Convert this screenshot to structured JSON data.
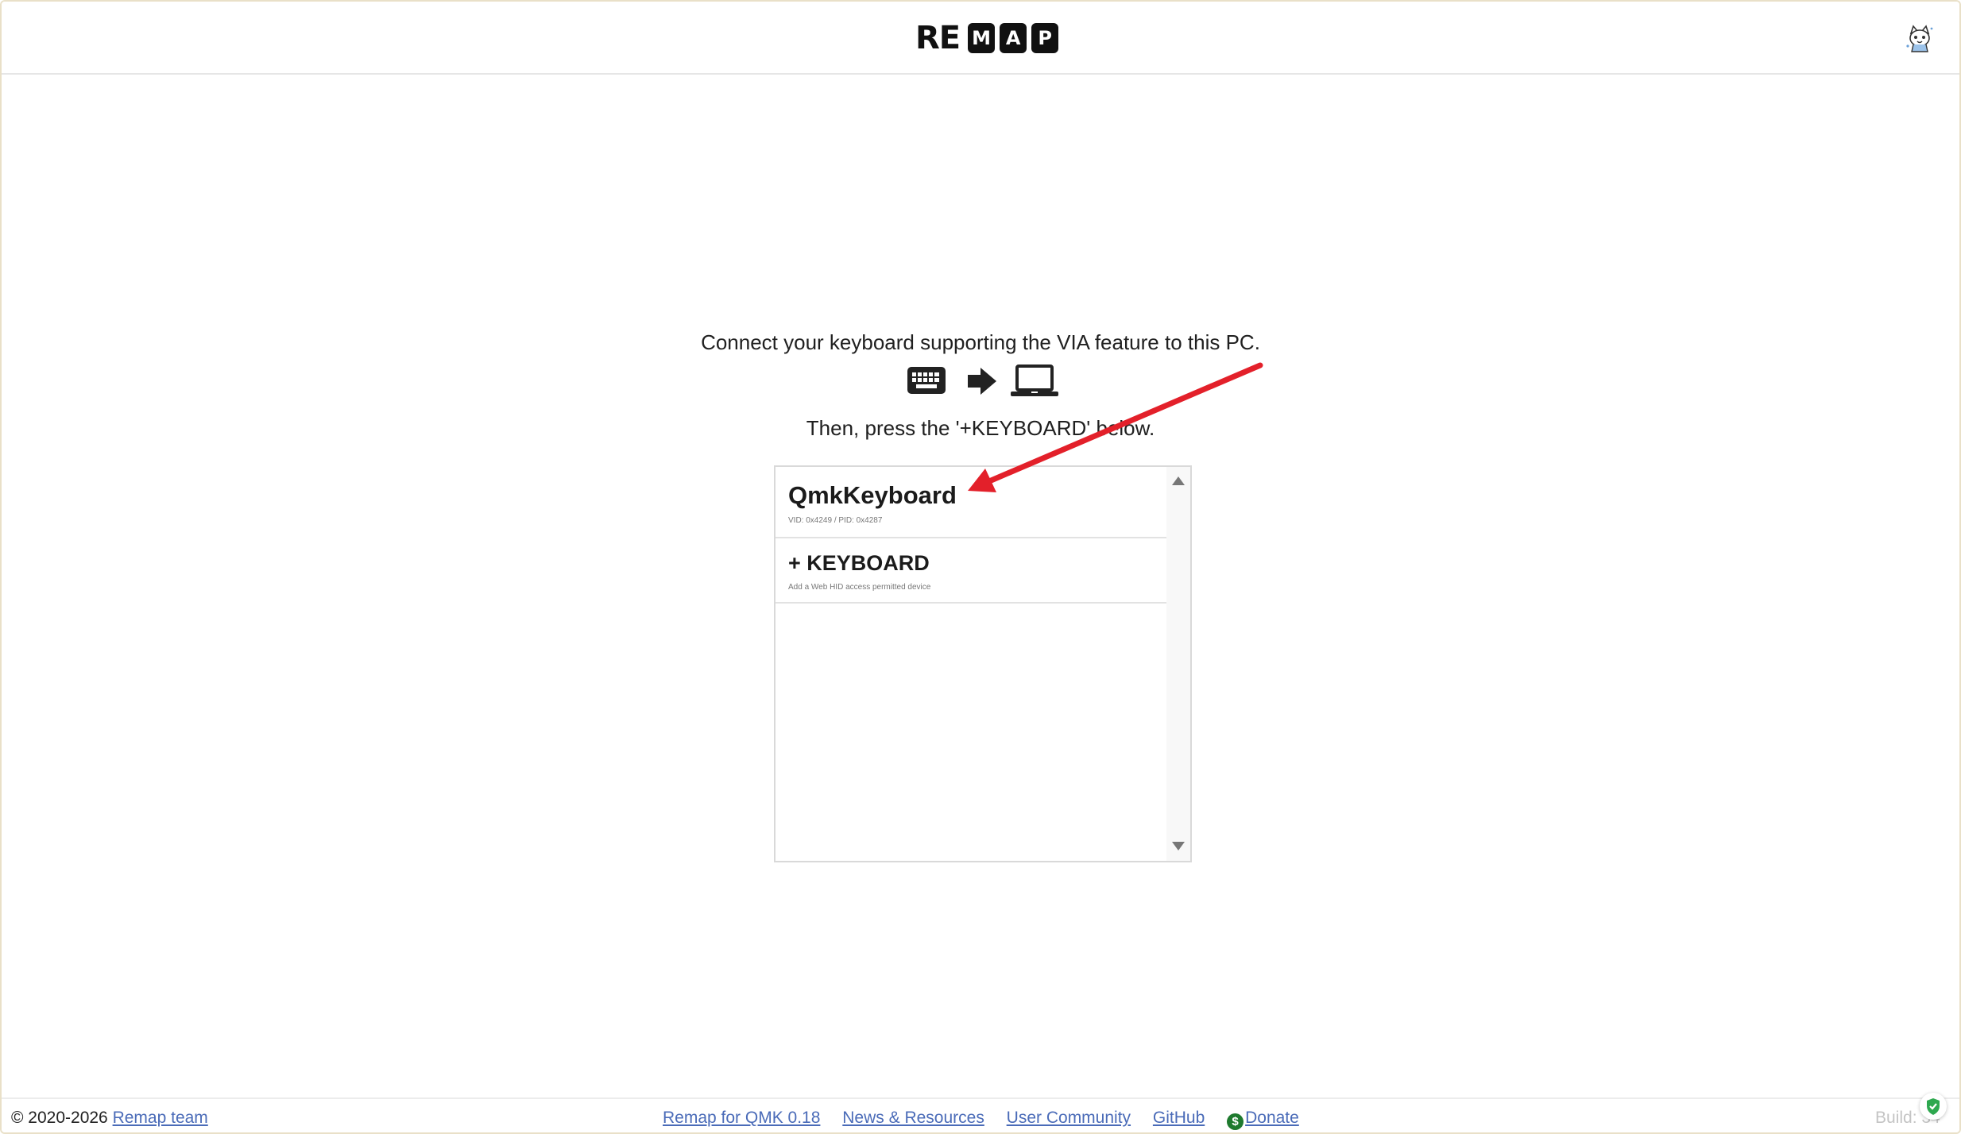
{
  "header": {
    "logo_prefix": "RE",
    "logo_letters": [
      "M",
      "A",
      "P"
    ],
    "avatar_icon": "cat-avatar-icon"
  },
  "main": {
    "instruction_line1": "Connect your keyboard supporting the VIA feature to this PC.",
    "instruction_icons": [
      "keyboard-icon",
      "arrow-right-icon",
      "laptop-icon"
    ],
    "instruction_line2": "Then, press the '+KEYBOARD' below."
  },
  "keyboard_list": {
    "items": [
      {
        "title": "QmkKeyboard",
        "subtitle": "VID: 0x4249 / PID: 0x4287"
      },
      {
        "title": "+ KEYBOARD",
        "subtitle": "Add a Web HID access permitted device"
      }
    ]
  },
  "annotation": {
    "color": "#e3202a"
  },
  "footer": {
    "copyright_prefix": "© 2020-2026",
    "team_link": "Remap team",
    "links": {
      "remap_qmk": "Remap for QMK 0.18",
      "news": "News & Resources",
      "community": "User Community",
      "github": "GitHub",
      "donate": "Donate"
    },
    "build_text": "Build: 34"
  },
  "colors": {
    "link": "#4a6bb8",
    "donate_icon": "#1e7a2e",
    "shield_icon": "#2ea84f"
  }
}
